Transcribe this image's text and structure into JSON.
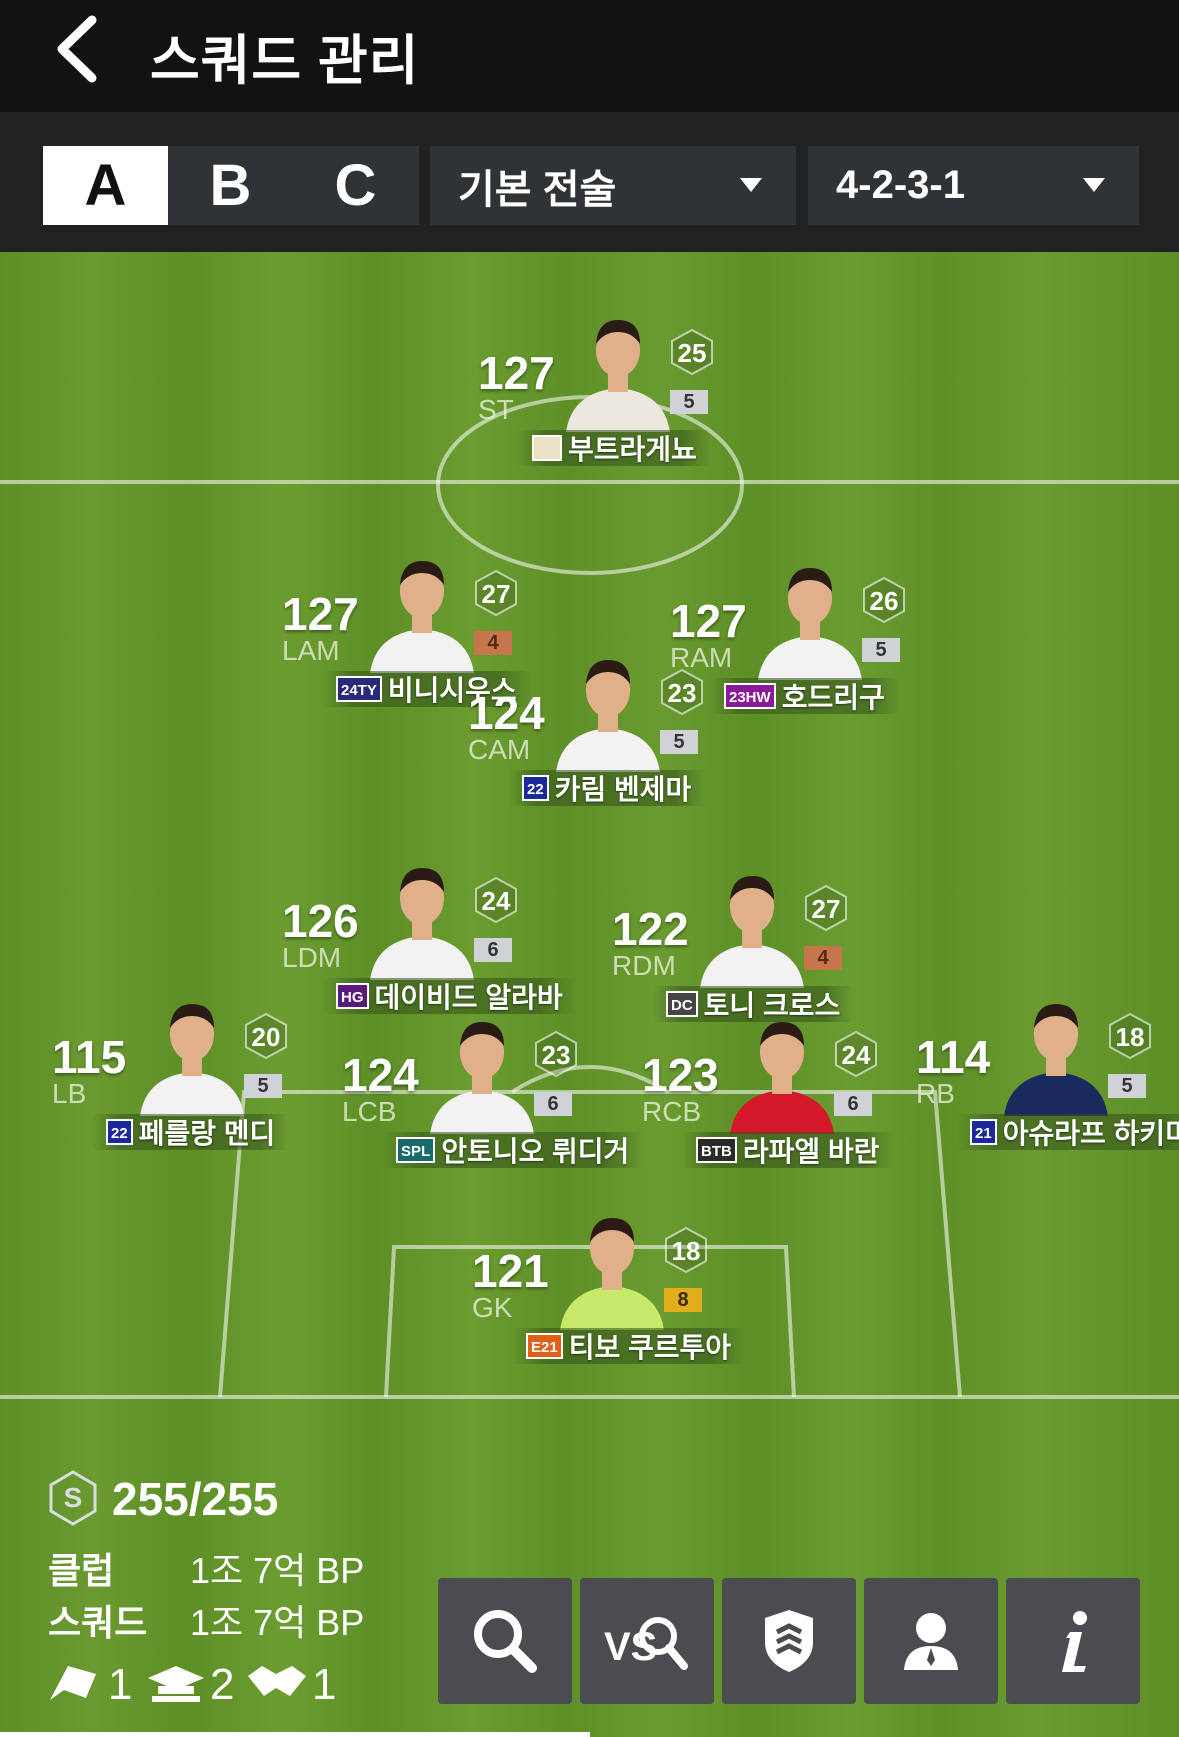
{
  "header": {
    "title": "스쿼드 관리"
  },
  "squad_tabs": [
    {
      "label": "A",
      "active": true
    },
    {
      "label": "B",
      "active": false
    },
    {
      "label": "C",
      "active": false
    }
  ],
  "tactic_dropdown": {
    "value": "기본 전술"
  },
  "formation_dropdown": {
    "value": "4-2-3-1"
  },
  "players": [
    {
      "id": "st",
      "rating": "127",
      "position": "ST",
      "hex": "25",
      "level": "5",
      "level_color": "silver",
      "season": "",
      "name": "부트라게뇨"
    },
    {
      "id": "lam",
      "rating": "127",
      "position": "LAM",
      "hex": "27",
      "level": "4",
      "level_color": "bronze",
      "season": "24TY",
      "name": "비니시우스"
    },
    {
      "id": "ram",
      "rating": "127",
      "position": "RAM",
      "hex": "26",
      "level": "5",
      "level_color": "silver",
      "season": "23HW",
      "name": "호드리구"
    },
    {
      "id": "cam",
      "rating": "124",
      "position": "CAM",
      "hex": "23",
      "level": "5",
      "level_color": "silver",
      "season": "22",
      "name": "카림 벤제마"
    },
    {
      "id": "ldm",
      "rating": "126",
      "position": "LDM",
      "hex": "24",
      "level": "6",
      "level_color": "silver",
      "season": "HG",
      "name": "데이비드 알라바"
    },
    {
      "id": "rdm",
      "rating": "122",
      "position": "RDM",
      "hex": "27",
      "level": "4",
      "level_color": "bronze",
      "season": "DC",
      "name": "토니 크로스"
    },
    {
      "id": "lb",
      "rating": "115",
      "position": "LB",
      "hex": "20",
      "level": "5",
      "level_color": "silver",
      "season": "22",
      "name": "페를랑 멘디"
    },
    {
      "id": "lcb",
      "rating": "124",
      "position": "LCB",
      "hex": "23",
      "level": "6",
      "level_color": "silver",
      "season": "SPL",
      "name": "안토니오 뤼디거"
    },
    {
      "id": "rcb",
      "rating": "123",
      "position": "RCB",
      "hex": "24",
      "level": "6",
      "level_color": "silver",
      "season": "BTB",
      "name": "라파엘 바란"
    },
    {
      "id": "rb",
      "rating": "114",
      "position": "RB",
      "hex": "18",
      "level": "5",
      "level_color": "silver",
      "season": "21",
      "name": "아슈라프 하키미"
    },
    {
      "id": "gk",
      "rating": "121",
      "position": "GK",
      "hex": "18",
      "level": "8",
      "level_color": "gold",
      "season": "E21",
      "name": "티보 쿠르투아"
    }
  ],
  "summary": {
    "salary": "255/255",
    "club_label": "클럽",
    "club_value": "1조 7억 BP",
    "squad_label": "스쿼드",
    "squad_value": "1조 7억 BP",
    "team_color_count_1": "1",
    "team_color_count_2": "2",
    "team_color_count_3": "1"
  },
  "actions": [
    "search-button",
    "vs-search-button",
    "team-button",
    "manager-button",
    "info-button"
  ]
}
